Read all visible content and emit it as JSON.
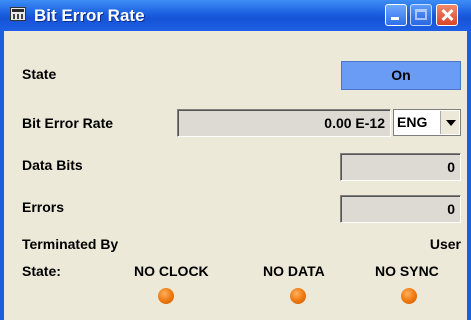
{
  "window": {
    "title": "Bit Error Rate"
  },
  "state": {
    "label": "State",
    "button": "On"
  },
  "ber": {
    "label": "Bit Error Rate",
    "value": "0.00 E-12",
    "unit": "ENG"
  },
  "data_bits": {
    "label": "Data Bits",
    "value": "0"
  },
  "errors": {
    "label": "Errors",
    "value": "0"
  },
  "terminated": {
    "label": "Terminated By",
    "value": "User"
  },
  "status": {
    "label": "State:",
    "indicators": [
      {
        "label": "NO CLOCK",
        "color": "#f07a10"
      },
      {
        "label": "NO DATA",
        "color": "#f07a10"
      },
      {
        "label": "NO SYNC",
        "color": "#f07a10"
      }
    ]
  }
}
